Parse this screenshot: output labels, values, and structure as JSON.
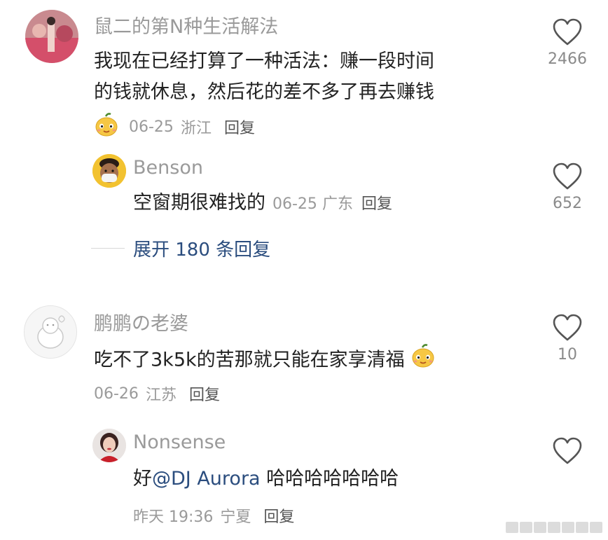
{
  "comments": [
    {
      "username": "鼠二的第N种生活解法",
      "text_line1": "我现在已经打算了一种活法：赚一段时间",
      "text_line2": "的钱就休息，然后花的差不多了再去赚钱",
      "date": "06-25",
      "location": "浙江",
      "reply": "回复",
      "likes": "2466",
      "replies": [
        {
          "username": "Benson",
          "text": "空窗期很难找的",
          "date": "06-25",
          "location": "广东",
          "reply": "回复",
          "likes": "652"
        }
      ],
      "expand": "展开 180 条回复"
    },
    {
      "username": "鹏鹏の老婆",
      "text": "吃不了3k5k的苦那就只能在家享清福",
      "date": "06-26",
      "location": "江苏",
      "reply": "回复",
      "likes": "10",
      "replies": [
        {
          "username": "Nonsense",
          "text_prefix": "好",
          "mention": "@DJ Aurora",
          "text_suffix": " 哈哈哈哈哈哈哈",
          "date": "昨天 19:36",
          "location": "宁夏",
          "reply": "回复"
        }
      ]
    }
  ],
  "icons": {
    "like": "heart-outline-icon",
    "emoji": "mango-face-emoji-icon"
  },
  "colors": {
    "text": "#222222",
    "secondary": "#9a9a9a",
    "link": "#2b4d7e"
  }
}
